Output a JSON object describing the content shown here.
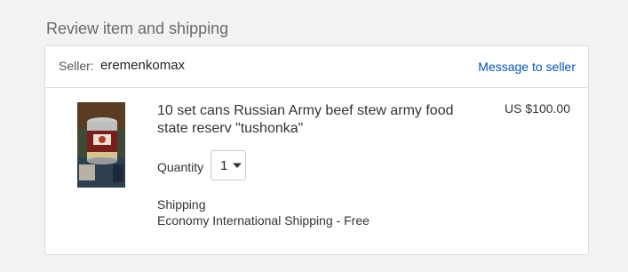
{
  "section": {
    "title": "Review item and shipping"
  },
  "seller": {
    "label": "Seller:",
    "name": "eremenkomax",
    "message_link": "Message to seller"
  },
  "item": {
    "title": "10 set cans Russian Army beef stew army food state reserv \"tushonka\"",
    "price": "US $100.00",
    "image_icon": "product-photo-can",
    "quantity_label": "Quantity",
    "quantity_value": "1",
    "shipping_label": "Shipping",
    "shipping_method": "Economy International Shipping - Free"
  },
  "colors": {
    "link": "#0654ba",
    "page_bg": "#f2f2f2",
    "border": "#dddddd"
  }
}
